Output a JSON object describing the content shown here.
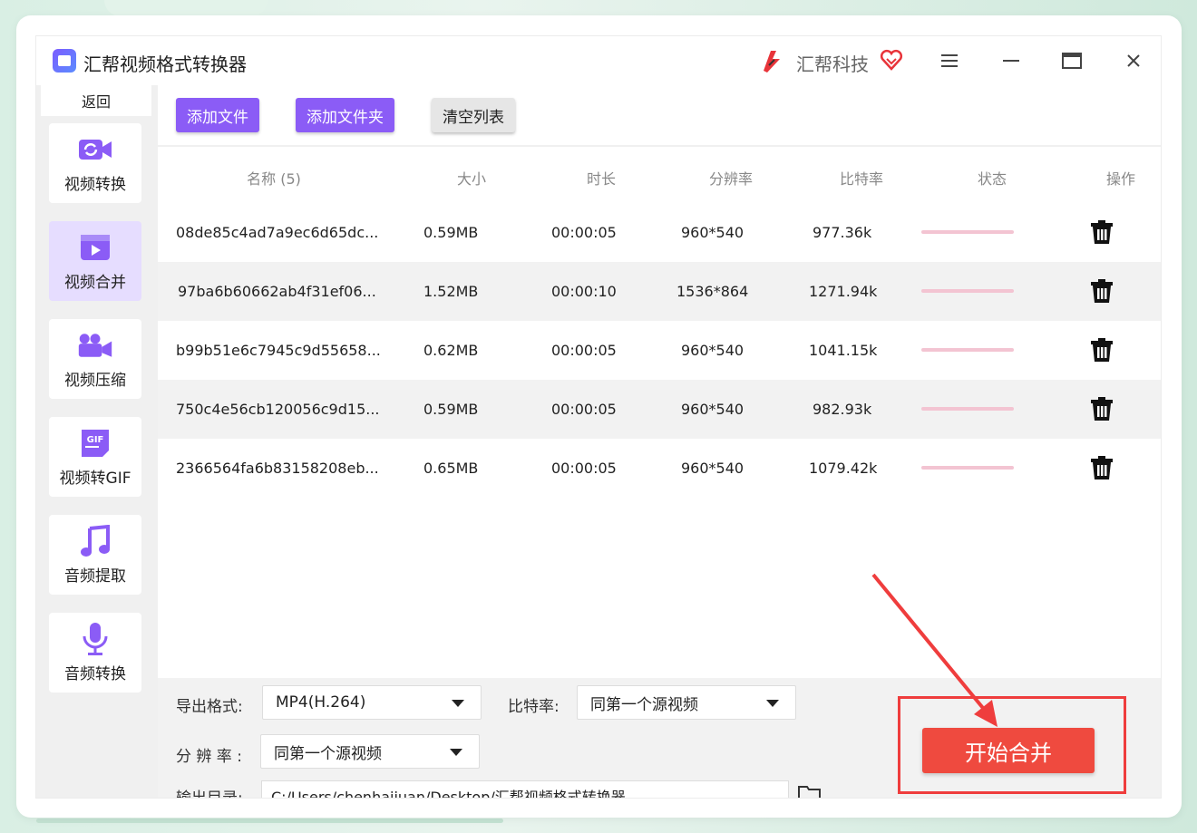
{
  "app": {
    "title": "汇帮视频格式转换器",
    "brand": "汇帮科技"
  },
  "sidebar": {
    "back": "返回",
    "items": [
      {
        "label": "视频转换",
        "icon": "video-convert-icon"
      },
      {
        "label": "视频合并",
        "icon": "video-merge-icon",
        "active": true
      },
      {
        "label": "视频压缩",
        "icon": "video-compress-icon"
      },
      {
        "label": "视频转GIF",
        "icon": "video-gif-icon",
        "badge": "GIF"
      },
      {
        "label": "音频提取",
        "icon": "music-note-icon"
      },
      {
        "label": "音频转换",
        "icon": "microphone-icon"
      }
    ]
  },
  "toolbar": {
    "add_file": "添加文件",
    "add_folder": "添加文件夹",
    "clear_list": "清空列表"
  },
  "table": {
    "headers": [
      "名称 (5)",
      "大小",
      "时长",
      "分辨率",
      "比特率",
      "状态",
      "操作"
    ],
    "rows": [
      {
        "name": "08de85c4ad7a9ec6d65dc...",
        "size": "0.59MB",
        "duration": "00:00:05",
        "resolution": "960*540",
        "bitrate": "977.36k"
      },
      {
        "name": "97ba6b60662ab4f31ef06...",
        "size": "1.52MB",
        "duration": "00:00:10",
        "resolution": "1536*864",
        "bitrate": "1271.94k"
      },
      {
        "name": "b99b51e6c7945c9d55658...",
        "size": "0.62MB",
        "duration": "00:00:05",
        "resolution": "960*540",
        "bitrate": "1041.15k"
      },
      {
        "name": "750c4e56cb120056c9d15...",
        "size": "0.59MB",
        "duration": "00:00:05",
        "resolution": "960*540",
        "bitrate": "982.93k"
      },
      {
        "name": "2366564fa6b83158208eb...",
        "size": "0.65MB",
        "duration": "00:00:05",
        "resolution": "960*540",
        "bitrate": "1079.42k"
      }
    ]
  },
  "settings": {
    "format_label": "导出格式:",
    "format_value": "MP4(H.264)",
    "bitrate_label": "比特率:",
    "bitrate_value": "同第一个源视频",
    "resolution_label": "分 辨 率 :",
    "resolution_value": "同第一个源视频",
    "output_label": "输出目录:",
    "output_path": "C:/Users/chenhaijuan/Desktop/汇帮视频格式转换器",
    "start_button": "开始合并"
  },
  "colors": {
    "accent": "#8b5cf6",
    "start": "#ef4a3f",
    "annotation": "#ef3d3d"
  }
}
